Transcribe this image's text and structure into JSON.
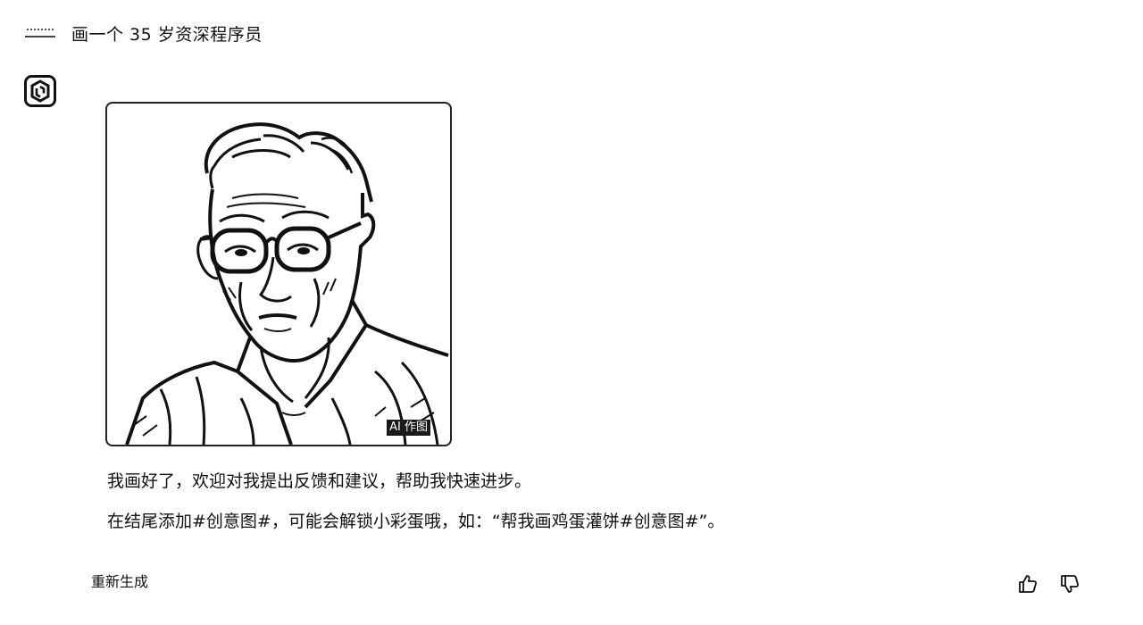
{
  "user_message": {
    "avatar_icon": "user-avatar-icon",
    "text": "画一个 35 岁资深程序员"
  },
  "bot": {
    "avatar_icon": "bot-logo-icon",
    "image": {
      "alt": "black-and-white line-art portrait of an elderly man with glasses",
      "watermark": "AI 作图"
    },
    "paragraphs": [
      "我画好了，欢迎对我提出反馈和建议，帮助我快速进步。",
      "在结尾添加#创意图#，可能会解锁小彩蛋哦，如：“帮我画鸡蛋灌饼#创意图#”。"
    ]
  },
  "footer": {
    "regenerate_label": "重新生成",
    "thumbs_up_icon": "thumbs-up-icon",
    "thumbs_down_icon": "thumbs-down-icon"
  }
}
